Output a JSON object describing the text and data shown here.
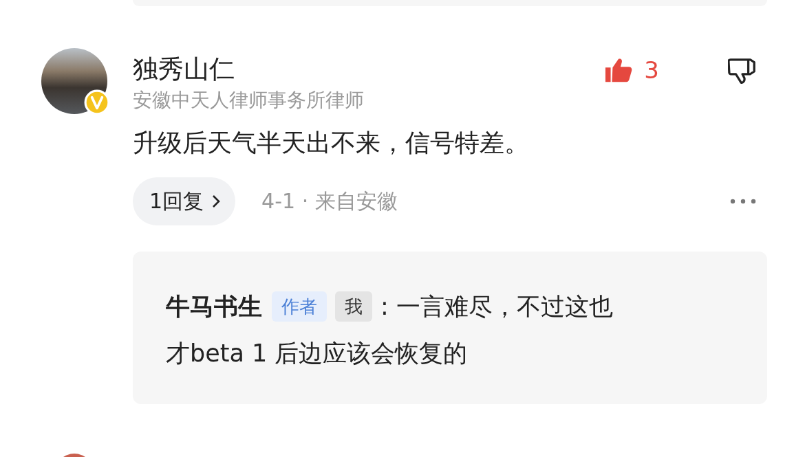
{
  "comment": {
    "author": "独秀山仁",
    "verified": true,
    "title": "安徽中天人律师事务所律师",
    "text": "升级后天气半天出不来，信号特差。",
    "likes": "3",
    "liked": true,
    "replies_button": "1回复",
    "meta": "4-1 · 来自安徽",
    "reply": {
      "author": "牛马书生",
      "tags": [
        {
          "label": "作者",
          "kind": "author"
        },
        {
          "label": "我",
          "kind": "me"
        }
      ],
      "text_lines": [
        ": 一言难尽，不过这也",
        "才beta 1 后边应该会恢复的"
      ]
    }
  }
}
